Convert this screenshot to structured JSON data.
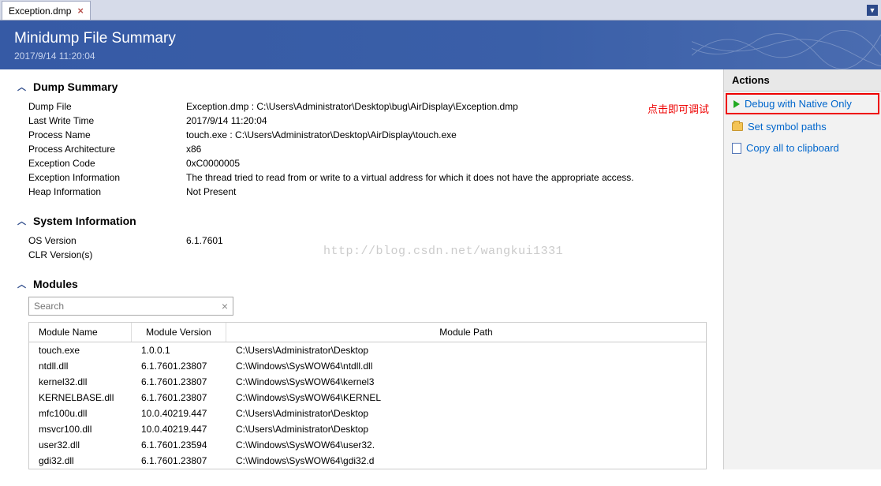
{
  "tab": {
    "label": "Exception.dmp"
  },
  "banner": {
    "title": "Minidump File Summary",
    "timestamp": "2017/9/14 11:20:04"
  },
  "dump_summary": {
    "heading": "Dump Summary",
    "rows": [
      {
        "key": "Dump File",
        "val": "Exception.dmp : C:\\Users\\Administrator\\Desktop\\bug\\AirDisplay\\Exception.dmp"
      },
      {
        "key": "Last Write Time",
        "val": "2017/9/14 11:20:04"
      },
      {
        "key": "Process Name",
        "val": "touch.exe : C:\\Users\\Administrator\\Desktop\\AirDisplay\\touch.exe"
      },
      {
        "key": "Process Architecture",
        "val": "x86"
      },
      {
        "key": "Exception Code",
        "val": "0xC0000005"
      },
      {
        "key": "Exception Information",
        "val": "The thread tried to read from or write to a virtual address for which it does not have the appropriate access."
      },
      {
        "key": "Heap Information",
        "val": "Not Present"
      }
    ]
  },
  "sys_info": {
    "heading": "System Information",
    "rows": [
      {
        "key": "OS Version",
        "val": "6.1.7601"
      },
      {
        "key": "CLR Version(s)",
        "val": ""
      }
    ]
  },
  "modules": {
    "heading": "Modules",
    "search_placeholder": "Search",
    "columns": {
      "name": "Module Name",
      "version": "Module Version",
      "path": "Module Path"
    },
    "rows": [
      {
        "name": "touch.exe",
        "version": "1.0.0.1",
        "path": "C:\\Users\\Administrator\\Desktop"
      },
      {
        "name": "ntdll.dll",
        "version": "6.1.7601.23807",
        "path": "C:\\Windows\\SysWOW64\\ntdll.dll"
      },
      {
        "name": "kernel32.dll",
        "version": "6.1.7601.23807",
        "path": "C:\\Windows\\SysWOW64\\kernel3"
      },
      {
        "name": "KERNELBASE.dll",
        "version": "6.1.7601.23807",
        "path": "C:\\Windows\\SysWOW64\\KERNEL"
      },
      {
        "name": "mfc100u.dll",
        "version": "10.0.40219.447",
        "path": "C:\\Users\\Administrator\\Desktop"
      },
      {
        "name": "msvcr100.dll",
        "version": "10.0.40219.447",
        "path": "C:\\Users\\Administrator\\Desktop"
      },
      {
        "name": "user32.dll",
        "version": "6.1.7601.23594",
        "path": "C:\\Windows\\SysWOW64\\user32."
      },
      {
        "name": "gdi32.dll",
        "version": "6.1.7601.23807",
        "path": "C:\\Windows\\SysWOW64\\gdi32.d"
      }
    ]
  },
  "actions": {
    "heading": "Actions",
    "debug": "Debug with Native Only",
    "symbol": "Set symbol paths",
    "copy": "Copy all to clipboard"
  },
  "annotation": "点击即可调试",
  "watermark": "http://blog.csdn.net/wangkui1331"
}
